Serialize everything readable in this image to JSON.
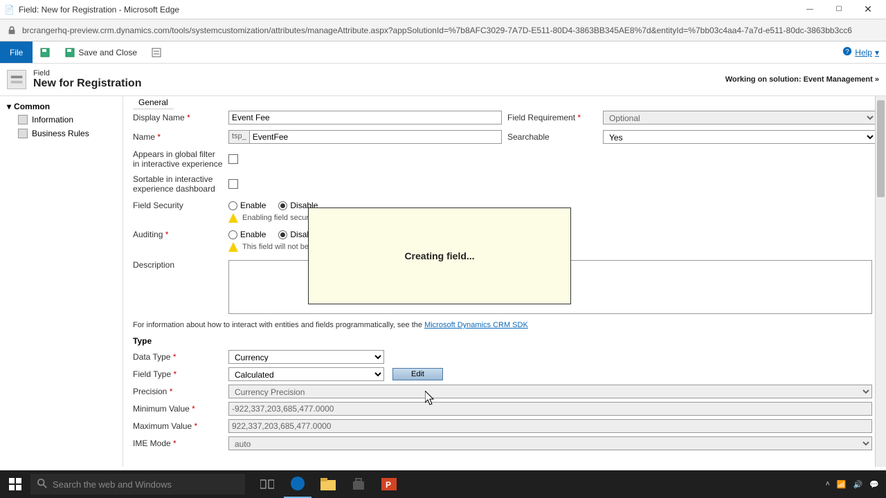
{
  "window": {
    "title": "Field: New for Registration - Microsoft Edge"
  },
  "address": {
    "url": "brcrangerhq-preview.crm.dynamics.com/tools/systemcustomization/attributes/manageAttribute.aspx?appSolutionId=%7b8AFC3029-7A7D-E511-80D4-3863BB345AE8%7d&entityId=%7bb03c4aa4-7a7d-e511-80dc-3863bb3cc6"
  },
  "commands": {
    "file": "File",
    "save_close": "Save and Close",
    "help": "Help"
  },
  "header": {
    "type": "Field",
    "name": "New for Registration",
    "solution_prefix": "Working on solution:",
    "solution_name": "Event Management"
  },
  "sidebar": {
    "section": "Common",
    "items": [
      "Information",
      "Business Rules"
    ]
  },
  "tab": {
    "label": "General"
  },
  "form": {
    "display_name_label": "Display Name",
    "display_name_value": "Event Fee",
    "field_requirement_label": "Field Requirement",
    "field_requirement_value": "Optional",
    "name_label": "Name",
    "name_prefix": "tsp_",
    "name_value": "EventFee",
    "searchable_label": "Searchable",
    "searchable_value": "Yes",
    "global_filter_label": "Appears in global filter in interactive experience",
    "sortable_label": "Sortable in interactive experience dashboard",
    "field_security_label": "Field Security",
    "enable": "Enable",
    "disable": "Disable",
    "security_warning": "Enabling field security?",
    "auditing_label": "Auditing",
    "auditing_warning": "This field will not be au",
    "description_label": "Description",
    "info_text": "For information about how to interact with entities and fields programmatically, see the ",
    "info_link": "Microsoft Dynamics CRM SDK"
  },
  "type": {
    "heading": "Type",
    "data_type_label": "Data Type",
    "data_type_value": "Currency",
    "field_type_label": "Field Type",
    "field_type_value": "Calculated",
    "edit": "Edit",
    "precision_label": "Precision",
    "precision_value": "Currency Precision",
    "min_label": "Minimum Value",
    "min_value": "-922,337,203,685,477.0000",
    "max_label": "Maximum Value",
    "max_value": "922,337,203,685,477.0000",
    "ime_label": "IME Mode",
    "ime_value": "auto"
  },
  "modal": {
    "message": "Creating field..."
  },
  "taskbar": {
    "search_placeholder": "Search the web and Windows"
  }
}
